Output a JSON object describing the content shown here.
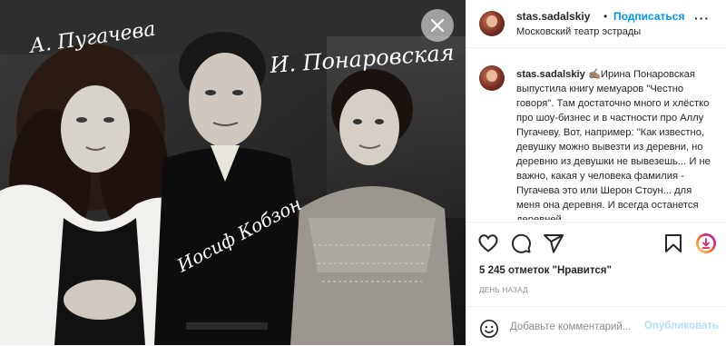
{
  "photo": {
    "signatures": [
      "А. Пугачева",
      "И. Понаровская",
      "Иосиф Кобзон"
    ]
  },
  "header": {
    "username": "stas.sadalskiy",
    "separator": "•",
    "follow_label": "Подписаться",
    "location": "Московский театр эстрады",
    "more": "···"
  },
  "caption": {
    "username": "stas.sadalskiy",
    "text": "✍🏽Ирина Понаровская выпустила книгу мемуаров \"Честно говоря\". Там достаточно много и хлёстко про шоу-бизнес и в частности про Аллу Пугачеву. Вот, например: \"Как известно, девушку можно вывезти из деревни, но деревню из девушки не вывезешь... И не важно, какая у человека фамилия - Пугачева это или Шерон Стоун... для меня она деревня. И всегда останется деревней"
  },
  "actions": {
    "icons": [
      "heart-icon",
      "comment-icon",
      "share-icon",
      "bookmark-icon",
      "reels-badge-icon"
    ]
  },
  "likes": "5 245 отметок \"Нравится\"",
  "time": "ДЕНЬ НАЗАД",
  "comment": {
    "placeholder": "Добавьте комментарий...",
    "post_label": "Опубликовать"
  },
  "colors": {
    "accent": "#0095f6",
    "post_disabled": "#b2dffc",
    "muted": "#8e8e8e",
    "border": "#efefef"
  }
}
